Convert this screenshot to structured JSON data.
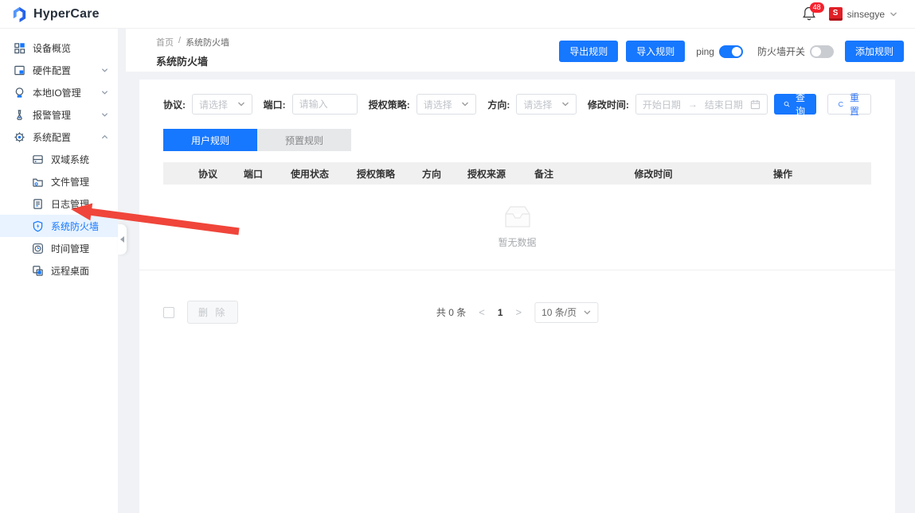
{
  "topbar": {
    "logo_text": "HyperCare",
    "notification_count": "48",
    "avatar_text": "S",
    "username": "sinsegye"
  },
  "sidebar": {
    "items": [
      {
        "label": "设备概览",
        "icon": "grid-icon"
      },
      {
        "label": "硬件配置",
        "icon": "hardware-icon"
      },
      {
        "label": "本地IO管理",
        "icon": "io-icon"
      },
      {
        "label": "报警管理",
        "icon": "alarm-icon"
      },
      {
        "label": "系统配置",
        "icon": "gear-icon"
      }
    ],
    "subitems": [
      {
        "label": "双域系统",
        "icon": "dual-domain-icon"
      },
      {
        "label": "文件管理",
        "icon": "file-gear-icon"
      },
      {
        "label": "日志管理",
        "icon": "log-icon"
      },
      {
        "label": "系统防火墙",
        "icon": "shield-icon",
        "active": true
      },
      {
        "label": "时间管理",
        "icon": "clock-icon"
      },
      {
        "label": "远程桌面",
        "icon": "remote-desktop-icon"
      }
    ]
  },
  "breadcrumb": {
    "home": "首页",
    "separator": "/",
    "current": "系统防火墙"
  },
  "toolbar": {
    "title": "系统防火墙",
    "export_label": "导出规则",
    "import_label": "导入规则",
    "ping_label": "ping",
    "ping_on": true,
    "firewall_label": "防火墙开关",
    "firewall_on": false,
    "add_label": "添加规则"
  },
  "filters": {
    "protocol_label": "协议:",
    "protocol_placeholder": "请选择",
    "port_label": "端口:",
    "port_placeholder": "请输入",
    "policy_label": "授权策略:",
    "policy_placeholder": "请选择",
    "direction_label": "方向:",
    "direction_placeholder": "请选择",
    "mtime_label": "修改时间:",
    "date_start_placeholder": "开始日期",
    "date_separator": "→",
    "date_end_placeholder": "结束日期",
    "search_label": "查询",
    "reset_label": "重置"
  },
  "tabs": {
    "user": "用户规则",
    "preset": "预置规则"
  },
  "table": {
    "columns": [
      "协议",
      "端口",
      "使用状态",
      "授权策略",
      "方向",
      "授权来源",
      "备注",
      "修改时间",
      "操作"
    ],
    "empty_text": "暂无数据"
  },
  "tfoot": {
    "delete_label": "删 除",
    "total_text": "共 0 条",
    "prev": "<",
    "page": "1",
    "next": ">",
    "page_size": "10 条/页"
  },
  "colors": {
    "primary": "#1677ff",
    "badge_red": "#f5222d",
    "arrow_red": "#f0453a",
    "active_item_bg": "#e8f3ff"
  }
}
